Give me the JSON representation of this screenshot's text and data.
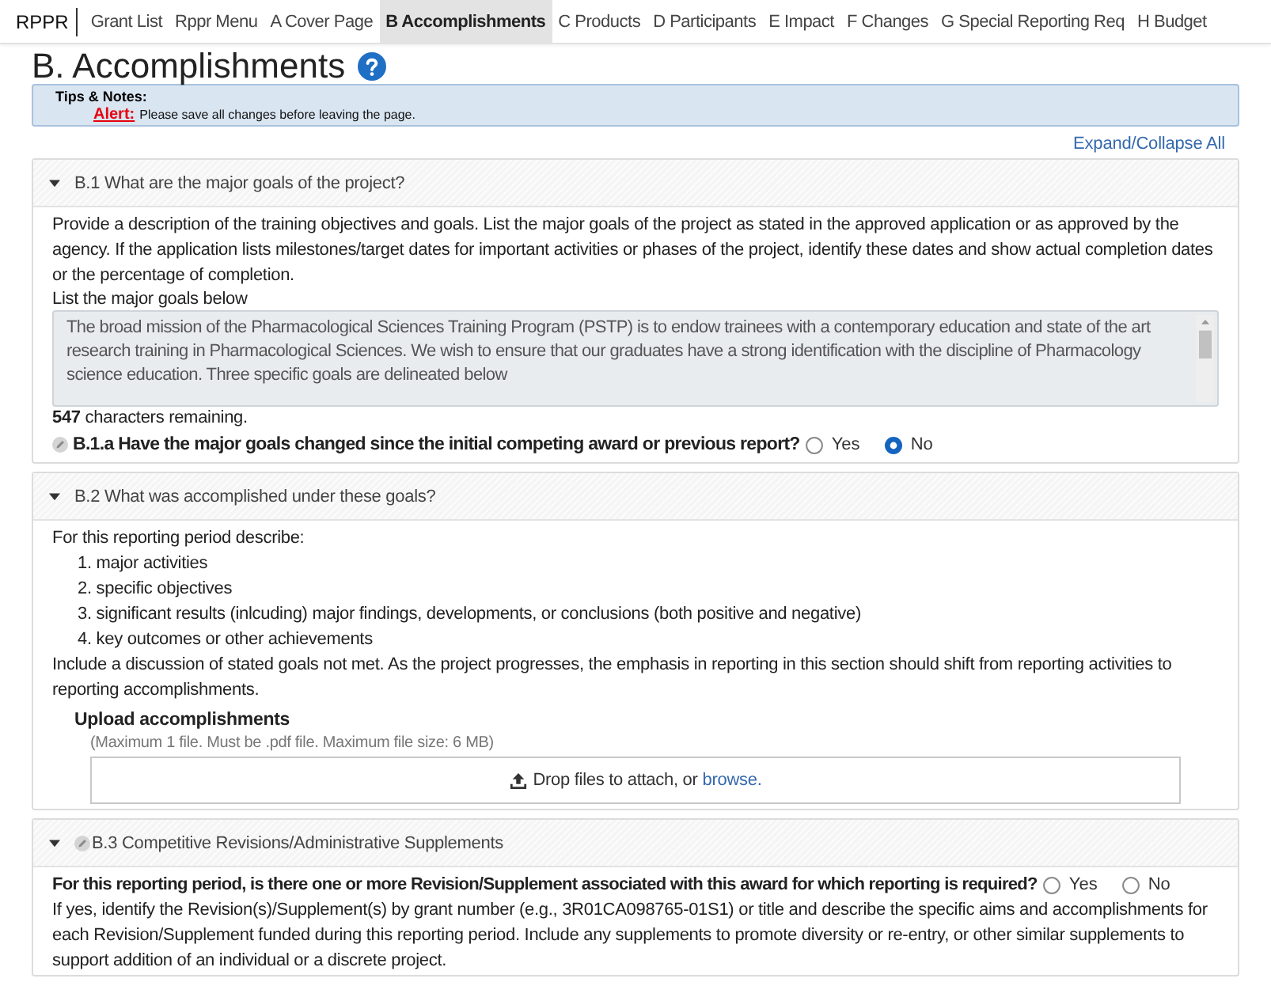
{
  "nav": {
    "brand": "RPPR",
    "items": [
      {
        "label": "Grant List",
        "selected": false
      },
      {
        "label": "Rppr Menu",
        "selected": false
      },
      {
        "label": "A Cover Page",
        "selected": false
      },
      {
        "label": "B Accomplishments",
        "selected": true
      },
      {
        "label": "C Products",
        "selected": false
      },
      {
        "label": "D Participants",
        "selected": false
      },
      {
        "label": "E Impact",
        "selected": false
      },
      {
        "label": "F Changes",
        "selected": false
      },
      {
        "label": "G Special Reporting Req",
        "selected": false
      },
      {
        "label": "H Budget",
        "selected": false
      }
    ]
  },
  "page": {
    "title": "B. Accomplishments"
  },
  "tips": {
    "heading": "Tips & Notes:",
    "alert_label": "Alert:",
    "alert_text": "Please save all changes before leaving the page."
  },
  "expand_collapse": "Expand/Collapse All",
  "sections": [
    {
      "title": "B.1 What are the major goals of the project?",
      "expanded": true,
      "edit_icon": false,
      "blocks": [
        {
          "kind": "paragraph",
          "text": "Provide a description of the training objectives and goals. List the major goals of the project as stated in the approved application or as approved by the agency. If the application lists milestones/target dates for important activities or phases of the project, identify these dates and show actual completion dates or the percentage of completion."
        },
        {
          "kind": "label",
          "text": "List the major goals below"
        },
        {
          "kind": "textarea",
          "value": "The broad mission of the Pharmacological Sciences Training Program (PSTP) is to endow trainees with a contemporary education and state of the art research training in Pharmacological Sciences. We wish to ensure that our graduates have a strong identification with the discipline of Pharmacology science education. Three specific goals are delineated below"
        },
        {
          "kind": "counter",
          "text": "**547** characters remaining."
        },
        {
          "kind": "question",
          "edit_icon": true,
          "text": "B.1.a Have the major goals changed since the initial competing award or previous report?",
          "options": [
            {
              "label": "Yes",
              "selected": false
            },
            {
              "label": "No",
              "selected": true
            }
          ]
        }
      ]
    },
    {
      "title": "B.2 What was accomplished under these goals?",
      "expanded": true,
      "edit_icon": false,
      "blocks": [
        {
          "kind": "paragraph",
          "text": "For this reporting period describe:"
        },
        {
          "kind": "list",
          "items": [
            "1. major activities",
            "2. specific objectives",
            "3. significant results (inlcuding) major findings, developments, or conclusions (both positive and negative)",
            "4. key outcomes or other achievements"
          ]
        },
        {
          "kind": "paragraph",
          "text": "Include a discussion of stated goals not met. As the project progresses, the emphasis in reporting in this section should shift from reporting activities to reporting accomplishments."
        },
        {
          "kind": "upload",
          "title": "Upload accomplishments",
          "hint": "(Maximum 1 file. Must be .pdf file. Maximum file size: 6 MB)",
          "drop_text": "Drop files to attach, or",
          "link": "browse."
        }
      ]
    },
    {
      "title": "B.3 Competitive Revisions/Administrative Supplements",
      "expanded": true,
      "edit_icon": true,
      "blocks": [
        {
          "kind": "question",
          "edit_icon": false,
          "text": "For this reporting period, is there one or more Revision/Supplement associated with this award for which reporting is required?",
          "options": [
            {
              "label": "Yes",
              "selected": false
            },
            {
              "label": "No",
              "selected": false
            }
          ]
        },
        {
          "kind": "paragraph",
          "text": "If yes, identify the Revision(s)/Supplement(s) by grant number (e.g., 3R01CA098765-01S1) or title and describe the specific aims and accomplishments for each Revision/Supplement funded during this reporting period. Include any supplements to promote diversity or re-entry, or other similar supplements to support addition of an individual or a discrete project."
        }
      ]
    }
  ]
}
